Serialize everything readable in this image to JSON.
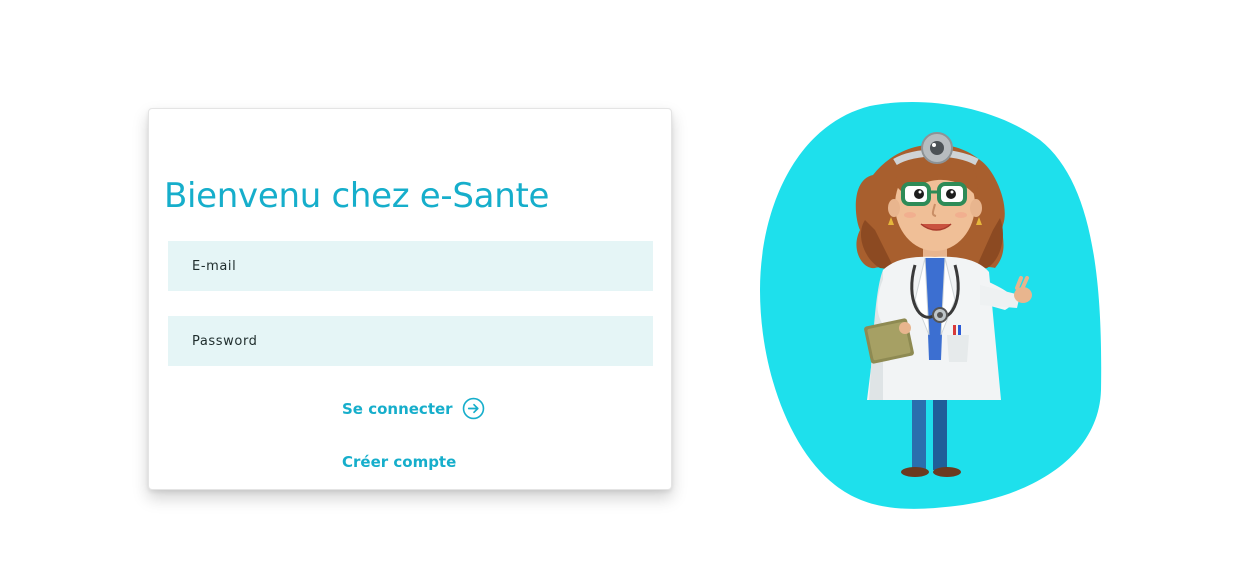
{
  "login_card": {
    "title": "Bienvenu chez e-Sante",
    "email_placeholder": "E-mail",
    "password_placeholder": "Password",
    "login_label": "Se connecter",
    "create_account_label": "Créer compte"
  },
  "illustration": {
    "icon": "doctor-illustration",
    "blob_color": "#1ee0ec"
  },
  "colors": {
    "accent": "#16aecb",
    "field_background": "#e5f5f6"
  }
}
